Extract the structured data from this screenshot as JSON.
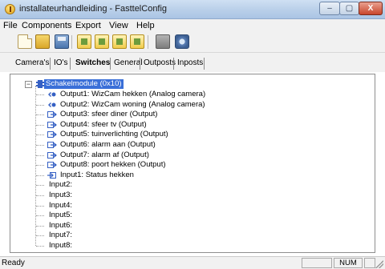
{
  "window": {
    "title": "installateurhandleiding - FasttelConfig",
    "buttons": {
      "minimize": "–",
      "maximize": "▢",
      "close": "X"
    }
  },
  "menu": [
    "File",
    "Components",
    "Export",
    "View",
    "Help"
  ],
  "toolbar": {
    "icons": [
      "new-file-icon",
      "open-folder-icon",
      "save-icon",
      "component-icon",
      "component-icon",
      "component-icon",
      "component-icon",
      "disabled-icon",
      "disk-icon"
    ]
  },
  "tabs": [
    "Camera's",
    "IO's",
    "Switches",
    "General",
    "Outposts",
    "Inposts"
  ],
  "active_tab": "Switches",
  "tree": {
    "root": "Schakelmodule (0x10)",
    "items": [
      {
        "label": "Output1: WizCam hekken (Analog camera)",
        "kind": "camera"
      },
      {
        "label": "Output2: WizCam woning (Analog camera)",
        "kind": "camera"
      },
      {
        "label": "Output3: sfeer diner (Output)",
        "kind": "output"
      },
      {
        "label": "Output4: sfeer tv (Output)",
        "kind": "output"
      },
      {
        "label": "Output5: tuinverlichting (Output)",
        "kind": "output"
      },
      {
        "label": "Output6: alarm aan (Output)",
        "kind": "output"
      },
      {
        "label": "Output7: alarm af (Output)",
        "kind": "output"
      },
      {
        "label": "Output8: poort hekken (Output)",
        "kind": "output"
      },
      {
        "label": "Input1: Status hekken",
        "kind": "input"
      },
      {
        "label": "Input2:",
        "kind": "empty"
      },
      {
        "label": "Input3:",
        "kind": "empty"
      },
      {
        "label": "Input4:",
        "kind": "empty"
      },
      {
        "label": "Input5:",
        "kind": "empty"
      },
      {
        "label": "Input6:",
        "kind": "empty"
      },
      {
        "label": "Input7:",
        "kind": "empty"
      },
      {
        "label": "Input8:",
        "kind": "empty"
      }
    ]
  },
  "status": {
    "text": "Ready",
    "num": "NUM"
  },
  "colors": {
    "selection": "#3a6fd8",
    "node_icon": "#3560c4"
  }
}
